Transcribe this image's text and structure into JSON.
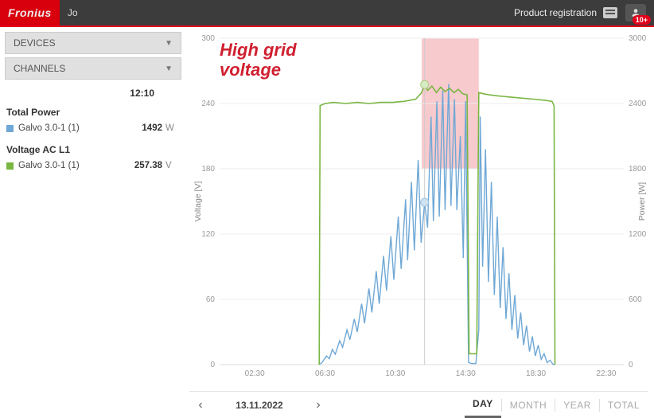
{
  "header": {
    "brand": "Fronius",
    "user": "Jo",
    "product_registration": "Product registration",
    "notifications_count": "10+"
  },
  "sidebar": {
    "accordion": {
      "devices": "DEVICES",
      "channels": "CHANNELS"
    },
    "cursor_time": "12:10",
    "metrics": [
      {
        "title": "Total Power",
        "series_name": "Galvo 3.0-1 (1)",
        "value": "1492",
        "unit": "W",
        "swatch": "sw-blue"
      },
      {
        "title": "Voltage AC L1",
        "series_name": "Galvo 3.0-1 (1)",
        "value": "257.38",
        "unit": "V",
        "swatch": "sw-green"
      }
    ]
  },
  "annotation": {
    "line1": "High grid",
    "line2": "voltage"
  },
  "datebar": {
    "date": "13.11.2022",
    "ranges": [
      "DAY",
      "MONTH",
      "YEAR",
      "TOTAL"
    ],
    "active": "DAY"
  },
  "colors": {
    "accent": "#e2001a",
    "power": "#6fa8d6",
    "voltage": "#7ab642",
    "highlight": "#e96a72"
  },
  "chart_data": {
    "type": "line",
    "title": "",
    "xlabel": "",
    "ylabel_left": "Voltage [V]",
    "ylabel_right": "Power [W]",
    "x_ticks": [
      "02:30",
      "06:30",
      "10:30",
      "14:30",
      "18:30",
      "22:30"
    ],
    "y_left": {
      "min": 0,
      "max": 300,
      "ticks": [
        0,
        60,
        120,
        180,
        240,
        300
      ]
    },
    "y_right": {
      "min": 0,
      "max": 3000,
      "ticks": [
        0,
        600,
        1200,
        1800,
        2400,
        3000
      ]
    },
    "x_range_minutes": [
      30,
      1410
    ],
    "cursor_minute": 730,
    "highlight_band_minutes": [
      720,
      915
    ],
    "series": [
      {
        "name": "Total Power (W)",
        "axis": "right",
        "color": "#6fa8d6",
        "points": [
          [
            370,
            0
          ],
          [
            380,
            20
          ],
          [
            395,
            80
          ],
          [
            405,
            55
          ],
          [
            415,
            140
          ],
          [
            425,
            95
          ],
          [
            440,
            220
          ],
          [
            450,
            160
          ],
          [
            465,
            320
          ],
          [
            475,
            230
          ],
          [
            490,
            420
          ],
          [
            500,
            300
          ],
          [
            515,
            560
          ],
          [
            525,
            380
          ],
          [
            540,
            700
          ],
          [
            550,
            480
          ],
          [
            565,
            860
          ],
          [
            575,
            560
          ],
          [
            590,
            1000
          ],
          [
            600,
            680
          ],
          [
            615,
            1180
          ],
          [
            625,
            780
          ],
          [
            640,
            1360
          ],
          [
            650,
            880
          ],
          [
            665,
            1520
          ],
          [
            672,
            960
          ],
          [
            685,
            1680
          ],
          [
            695,
            1050
          ],
          [
            708,
            1880
          ],
          [
            718,
            1120
          ],
          [
            730,
            1492
          ],
          [
            740,
            1260
          ],
          [
            752,
            2280
          ],
          [
            760,
            1320
          ],
          [
            772,
            2420
          ],
          [
            780,
            1360
          ],
          [
            792,
            2520
          ],
          [
            800,
            1420
          ],
          [
            812,
            2580
          ],
          [
            820,
            1460
          ],
          [
            832,
            2440
          ],
          [
            840,
            1420
          ],
          [
            852,
            2100
          ],
          [
            862,
            980
          ],
          [
            870,
            2420
          ],
          [
            880,
            20
          ],
          [
            890,
            10
          ],
          [
            905,
            10
          ],
          [
            915,
            320
          ],
          [
            920,
            2280
          ],
          [
            928,
            900
          ],
          [
            938,
            1980
          ],
          [
            948,
            760
          ],
          [
            958,
            1680
          ],
          [
            968,
            640
          ],
          [
            978,
            1360
          ],
          [
            988,
            520
          ],
          [
            998,
            1080
          ],
          [
            1008,
            420
          ],
          [
            1018,
            840
          ],
          [
            1028,
            320
          ],
          [
            1038,
            640
          ],
          [
            1048,
            240
          ],
          [
            1058,
            480
          ],
          [
            1068,
            180
          ],
          [
            1078,
            360
          ],
          [
            1088,
            120
          ],
          [
            1098,
            260
          ],
          [
            1108,
            80
          ],
          [
            1118,
            180
          ],
          [
            1128,
            50
          ],
          [
            1138,
            100
          ],
          [
            1148,
            20
          ],
          [
            1158,
            40
          ],
          [
            1168,
            5
          ],
          [
            1175,
            0
          ]
        ]
      },
      {
        "name": "Voltage AC L1 (V)",
        "axis": "left",
        "color": "#7ab642",
        "points": [
          [
            370,
            0
          ],
          [
            373,
            238
          ],
          [
            390,
            240
          ],
          [
            420,
            241
          ],
          [
            460,
            240
          ],
          [
            500,
            241
          ],
          [
            540,
            240
          ],
          [
            580,
            241
          ],
          [
            620,
            241
          ],
          [
            660,
            242
          ],
          [
            700,
            244
          ],
          [
            720,
            250
          ],
          [
            730,
            257.38
          ],
          [
            740,
            252
          ],
          [
            755,
            256
          ],
          [
            770,
            250
          ],
          [
            785,
            255
          ],
          [
            800,
            251
          ],
          [
            815,
            254
          ],
          [
            830,
            250
          ],
          [
            845,
            253
          ],
          [
            860,
            249
          ],
          [
            875,
            248
          ],
          [
            882,
            10
          ],
          [
            895,
            10
          ],
          [
            908,
            10
          ],
          [
            915,
            250
          ],
          [
            930,
            249
          ],
          [
            950,
            248
          ],
          [
            980,
            247
          ],
          [
            1020,
            246
          ],
          [
            1060,
            245
          ],
          [
            1100,
            244
          ],
          [
            1140,
            243
          ],
          [
            1165,
            242
          ],
          [
            1172,
            238
          ],
          [
            1175,
            0
          ]
        ]
      }
    ]
  }
}
